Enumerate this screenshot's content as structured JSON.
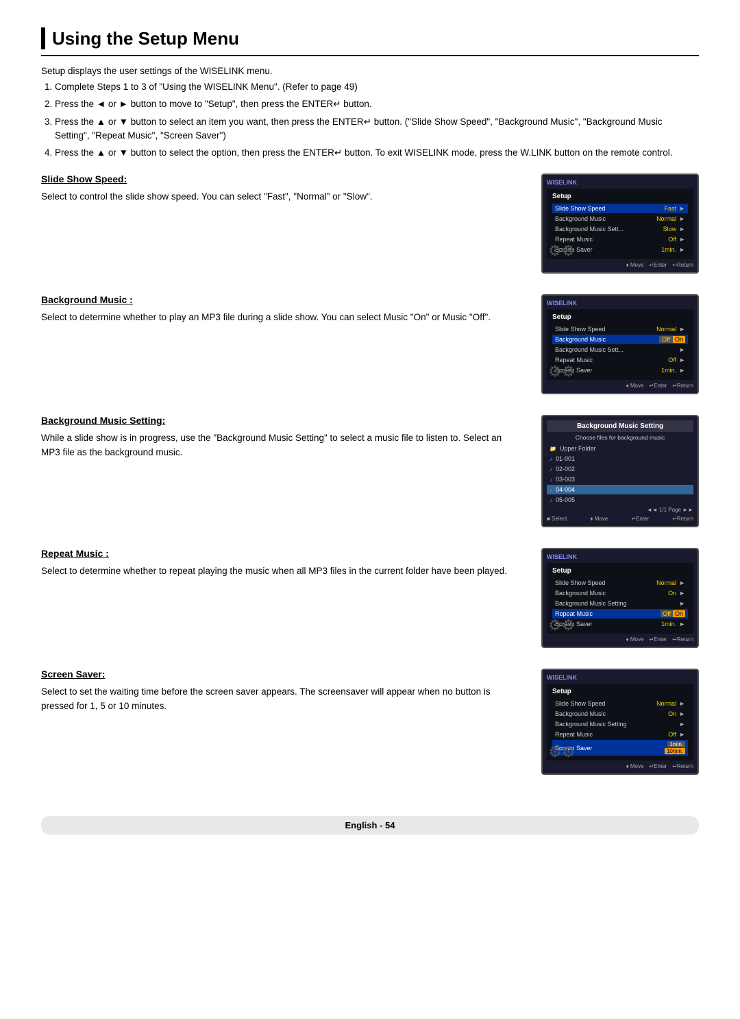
{
  "page": {
    "title": "Using the Setup Menu",
    "intro": "Setup displays the user settings of the WISELINK menu.",
    "steps": [
      "Complete Steps 1 to 3 of \"Using the WISELINK Menu\". (Refer to page 49)",
      "Press the ◄ or ► button to move to \"Setup\", then press the ENTER↵ button.",
      "Press the ▲ or ▼ button to select an item you want, then press the ENTER↵ button. (\"Slide Show Speed\", \"Background Music\", \"Background Music Setting\", \"Repeat Music\", \"Screen Saver\")",
      "Press the ▲ or ▼ button to select the option, then press the ENTER↵ button. To exit WISELINK mode, press the W.LINK button on the remote control."
    ]
  },
  "sections": [
    {
      "id": "slide-show-speed",
      "heading": "Slide Show Speed:",
      "body": "Select to control the slide show speed. You can select \"Fast\", \"Normal\" or \"Slow\"."
    },
    {
      "id": "background-music",
      "heading": "Background Music :",
      "body": "Select to determine whether to play an MP3 file during a slide show. You can select Music \"On\" or Music \"Off\"."
    },
    {
      "id": "background-music-setting",
      "heading": "Background Music Setting:",
      "body": "While a slide show is in progress, use the \"Background Music Setting\" to select a music file to listen to. Select an MP3 file as the background music."
    },
    {
      "id": "repeat-music",
      "heading": "Repeat Music :",
      "body": "Select to determine whether to repeat playing the music when all MP3 files in the current folder have been played."
    },
    {
      "id": "screen-saver",
      "heading": "Screen Saver:",
      "body": "Select to set the waiting time before the screen saver appears. The screensaver will appear when no button is pressed for 1, 5 or 10 minutes."
    }
  ],
  "screens": {
    "screen1": {
      "brand": "WISELINK",
      "menu_label": "Setup",
      "rows": [
        {
          "label": "Slide Show Speed",
          "value": "Fast",
          "selected": true
        },
        {
          "label": "Background Music",
          "value": "Normal",
          "selected": false
        },
        {
          "label": "Background Music Setti...",
          "value": "Slow",
          "selected": false
        },
        {
          "label": "Repeat Music",
          "value": "Off",
          "selected": false
        },
        {
          "label": "Screen Saver",
          "value": "1min.",
          "selected": false
        }
      ],
      "footer": [
        "♦ Move",
        "↵ Enter",
        "↩ Return"
      ]
    },
    "screen2": {
      "brand": "WISELINK",
      "menu_label": "Setup",
      "rows": [
        {
          "label": "Slide Show Speed",
          "value": "Normal",
          "selected": false
        },
        {
          "label": "Background Music",
          "value": "Off",
          "selected": true,
          "highlight_val": "On"
        },
        {
          "label": "Background Music Setti...",
          "value": "",
          "selected": false
        },
        {
          "label": "Repeat Music",
          "value": "Off",
          "selected": false
        },
        {
          "label": "Screen Saver",
          "value": "1min.",
          "selected": false
        }
      ],
      "footer": [
        "♦ Move",
        "↵ Enter",
        "↩ Return"
      ]
    },
    "screen3": {
      "title": "Background Music Setting",
      "subtitle": "Choose files for background music",
      "items": [
        {
          "name": "Upper Folder",
          "type": "folder",
          "selected": false
        },
        {
          "name": "01-001",
          "type": "music",
          "selected": false
        },
        {
          "name": "02-002",
          "type": "music",
          "selected": false
        },
        {
          "name": "03-003",
          "type": "music",
          "selected": false
        },
        {
          "name": "04-004",
          "type": "music",
          "selected": true
        },
        {
          "name": "05-005",
          "type": "music",
          "selected": false
        }
      ],
      "page_info": "◄◄ 1/1 Page ►►",
      "footer": [
        "■ Select",
        "♦ Move",
        "↵ Enter",
        "↩ Return"
      ]
    },
    "screen4": {
      "brand": "WISELINK",
      "menu_label": "Setup",
      "rows": [
        {
          "label": "Slide Show Speed",
          "value": "Normal",
          "selected": false
        },
        {
          "label": "Background Music",
          "value": "On",
          "selected": false
        },
        {
          "label": "Background Music Setting",
          "value": "",
          "selected": false
        },
        {
          "label": "Repeat Music",
          "value": "Off",
          "selected": true,
          "highlight_val": "On"
        },
        {
          "label": "Screen Saver",
          "value": "1min.",
          "selected": false
        }
      ],
      "footer": [
        "♦ Move",
        "↵ Enter",
        "↩ Return"
      ]
    },
    "screen5": {
      "brand": "WISELINK",
      "menu_label": "Setup",
      "rows": [
        {
          "label": "Slide Show Speed",
          "value": "Normal",
          "selected": false
        },
        {
          "label": "Background Music",
          "value": "On",
          "selected": false
        },
        {
          "label": "Background Music Setting",
          "value": "",
          "selected": false
        },
        {
          "label": "Repeat Music",
          "value": "Off",
          "selected": false
        },
        {
          "label": "Screen Saver",
          "value": "1min.",
          "selected": true,
          "highlight_val": "1min.\n10min."
        }
      ],
      "footer": [
        "♦ Move",
        "↵ Enter",
        "↩ Return"
      ]
    }
  },
  "footer": {
    "label": "English - 54"
  }
}
